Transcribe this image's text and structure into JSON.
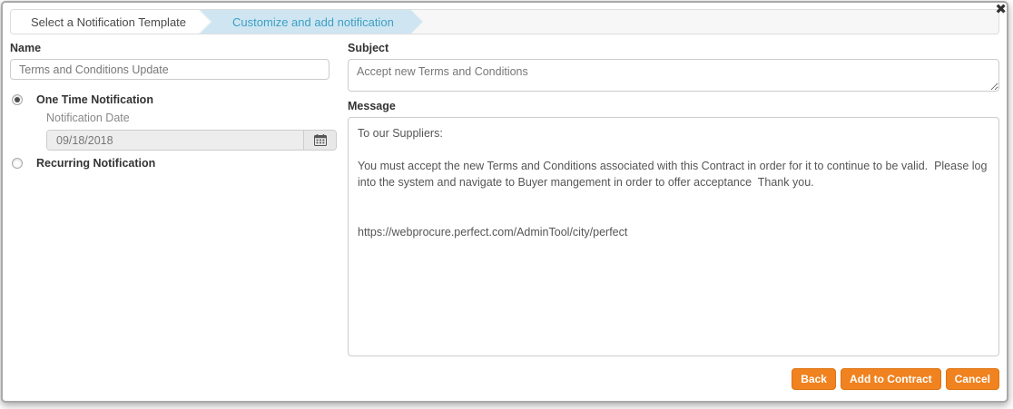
{
  "modal": {
    "close_icon": "✖"
  },
  "wizard": {
    "steps": [
      {
        "label": "Select a Notification Template",
        "active": false
      },
      {
        "label": "Customize and add notification",
        "active": true
      }
    ]
  },
  "form": {
    "name": {
      "label": "Name",
      "value": "Terms and Conditions Update"
    },
    "notification_type": {
      "one_time": {
        "label": "One Time Notification",
        "selected": true
      },
      "recurring": {
        "label": "Recurring Notification",
        "selected": false
      }
    },
    "notification_date": {
      "label": "Notification Date",
      "value": "09/18/2018"
    },
    "subject": {
      "label": "Subject",
      "value": "Accept new Terms and Conditions"
    },
    "message": {
      "label": "Message",
      "value": "To our Suppliers:\n\nYou must accept the new Terms and Conditions associated with this Contract in order for it to continue to be valid.  Please log into the system and navigate to Buyer mangement in order to offer acceptance  Thank you.\n\n\nhttps://webprocure.perfect.com/AdminTool/city/perfect"
    }
  },
  "footer": {
    "back_label": "Back",
    "add_label": "Add to Contract",
    "cancel_label": "Cancel"
  },
  "colors": {
    "accent_orange": "#f0821f",
    "active_step_text": "#3d9fc4",
    "active_step_bg": "#cfe6f2"
  }
}
